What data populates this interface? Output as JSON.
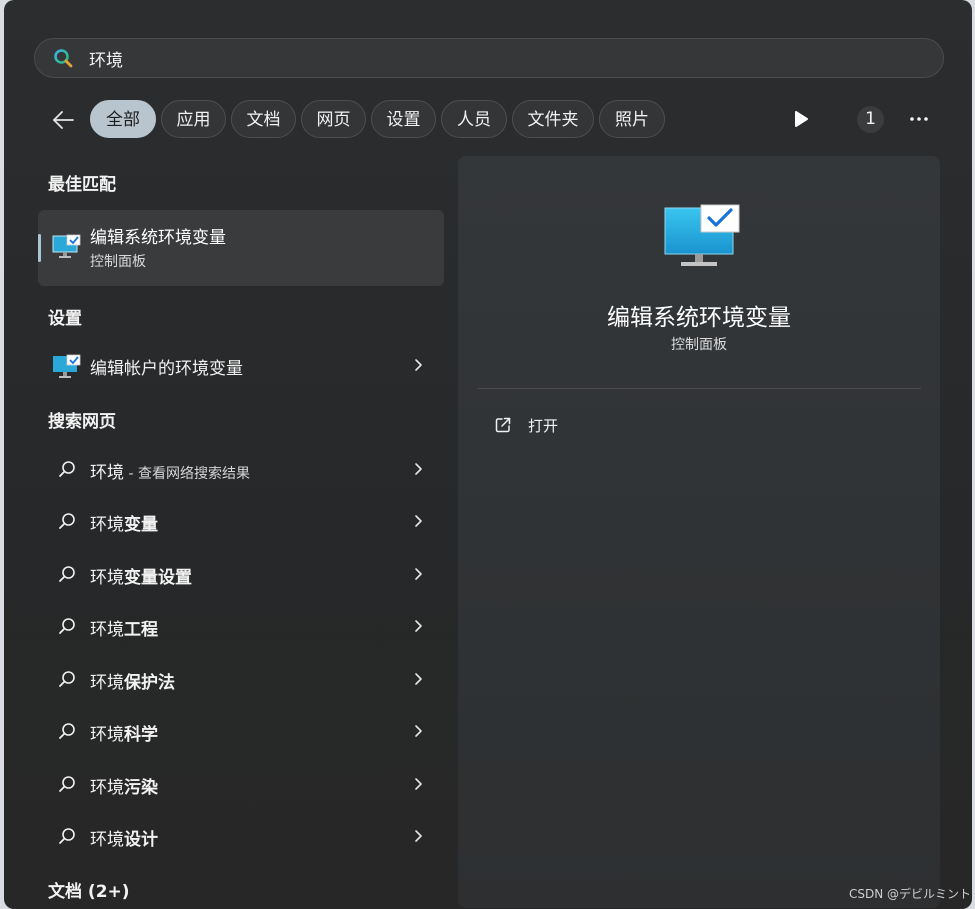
{
  "search": {
    "query": "环境"
  },
  "filters": [
    {
      "label": "全部",
      "active": true
    },
    {
      "label": "应用"
    },
    {
      "label": "文档"
    },
    {
      "label": "网页"
    },
    {
      "label": "设置"
    },
    {
      "label": "人员"
    },
    {
      "label": "文件夹"
    },
    {
      "label": "照片"
    }
  ],
  "toolbar": {
    "badge": "1"
  },
  "sections": {
    "best_match": "最佳匹配",
    "settings": "设置",
    "web": "搜索网页",
    "docs": "文档 (2+)"
  },
  "best_match": {
    "title": "编辑系统环境变量",
    "subtitle": "控制面板"
  },
  "settings_items": [
    {
      "label": "编辑帐户的环境变量"
    }
  ],
  "web_items": [
    {
      "prefix": "环境",
      "bold": "",
      "hint": " - 查看网络搜索结果"
    },
    {
      "prefix": "环境",
      "bold": "变量",
      "hint": ""
    },
    {
      "prefix": "环境",
      "bold": "变量设置",
      "hint": ""
    },
    {
      "prefix": "环境",
      "bold": "工程",
      "hint": ""
    },
    {
      "prefix": "环境",
      "bold": "保护法",
      "hint": ""
    },
    {
      "prefix": "环境",
      "bold": "科学",
      "hint": ""
    },
    {
      "prefix": "环境",
      "bold": "污染",
      "hint": ""
    },
    {
      "prefix": "环境",
      "bold": "设计",
      "hint": ""
    }
  ],
  "preview": {
    "title": "编辑系统环境变量",
    "subtitle": "控制面板",
    "actions": [
      {
        "label": "打开"
      }
    ]
  },
  "watermark": "CSDN @デビルミント",
  "colors": {
    "accent": "#a9c6d4",
    "active_pill": "#b8c5ce",
    "panel": "#2b2d2f"
  }
}
